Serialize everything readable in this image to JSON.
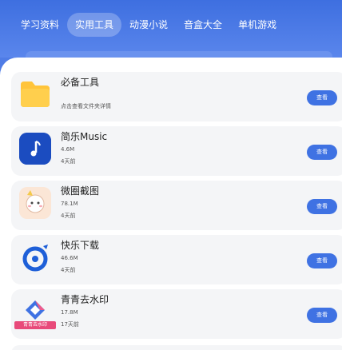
{
  "tabs": [
    {
      "label": "学习资料"
    },
    {
      "label": "实用工具",
      "active": true
    },
    {
      "label": "动漫小说"
    },
    {
      "label": "音盒大全"
    },
    {
      "label": "单机游戏"
    }
  ],
  "apps": [
    {
      "name": "必备工具",
      "size": "",
      "date": "点击查看文件夹详情",
      "button": "查看",
      "icon": "folder-icon"
    },
    {
      "name": "简乐Music",
      "size": "4.6M",
      "date": "4天前",
      "button": "查看",
      "icon": "music-note-icon"
    },
    {
      "name": "微圈截图",
      "size": "78.1M",
      "date": "4天前",
      "button": "查看",
      "icon": "cartoon-character-icon"
    },
    {
      "name": "快乐下载",
      "size": "46.6M",
      "date": "4天前",
      "button": "查看",
      "icon": "download-logo-icon"
    },
    {
      "name": "青青去水印",
      "size": "17.8M",
      "date": "17天前",
      "button": "查看",
      "icon": "watermark-logo-icon",
      "badge": "青青去水印"
    }
  ],
  "colors": {
    "accent": "#3f72e3",
    "header": "#4f7ce6"
  }
}
